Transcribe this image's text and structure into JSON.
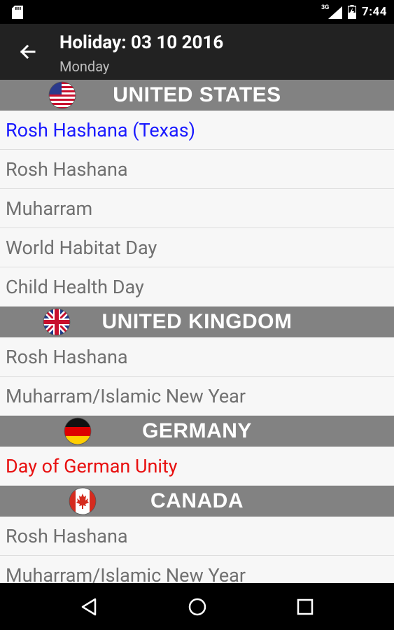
{
  "status_bar": {
    "time": "7:44",
    "network": "3G"
  },
  "app_bar": {
    "title": "Holiday: 03 10 2016",
    "subtitle": "Monday"
  },
  "colors": {
    "app_bar": "#222222",
    "section_header": "#828282",
    "blue_holiday": "#1a1aff",
    "red_holiday": "#e81010",
    "regular_holiday": "#707070"
  },
  "sections": [
    {
      "country": "UNITED STATES",
      "flag_icon": "us-flag-icon",
      "holidays": [
        "Rosh Hashana (Texas)",
        "Rosh Hashana",
        "Muharram",
        "World Habitat Day",
        "Child Health Day"
      ]
    },
    {
      "country": "UNITED KINGDOM",
      "flag_icon": "uk-flag-icon",
      "holidays": [
        "Rosh Hashana",
        "Muharram/Islamic New Year"
      ]
    },
    {
      "country": "GERMANY",
      "flag_icon": "germany-flag-icon",
      "holidays": [
        "Day of German Unity"
      ]
    },
    {
      "country": "CANADA",
      "flag_icon": "canada-flag-icon",
      "holidays": [
        "Rosh Hashana",
        "Muharram/Islamic New Year"
      ]
    }
  ],
  "nav_bar": {
    "back": "back-triangle-icon",
    "home": "home-circle-icon",
    "recents": "recents-square-icon"
  }
}
